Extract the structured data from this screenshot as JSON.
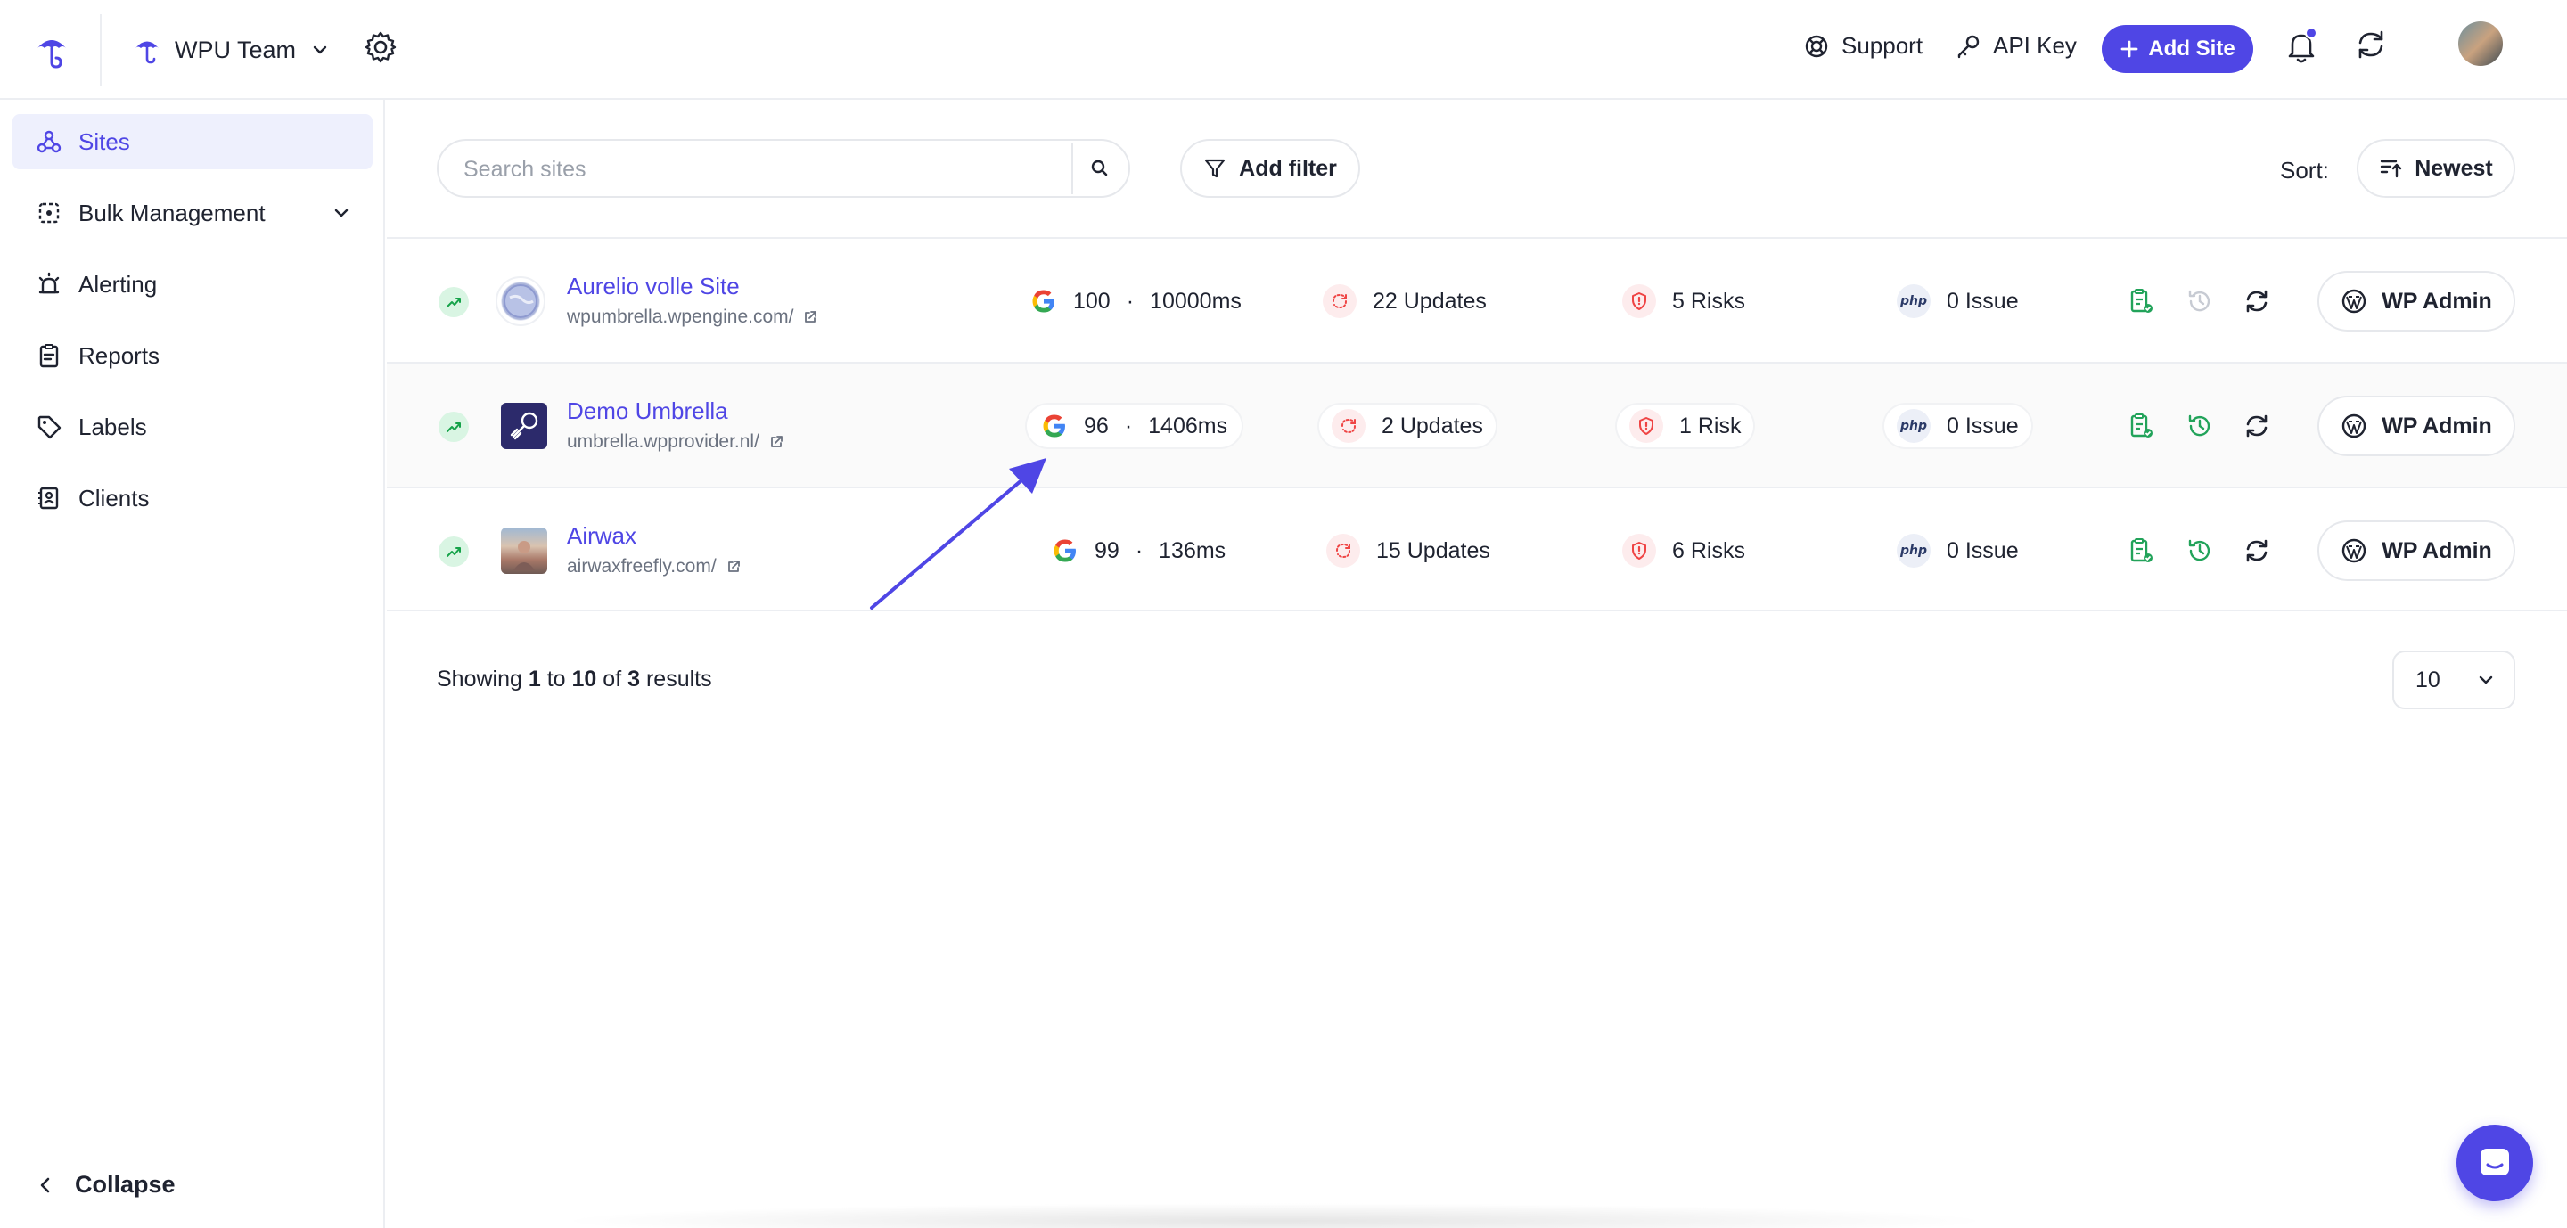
{
  "header": {
    "team_name": "WPU Team",
    "support_label": "Support",
    "api_key_label": "API Key",
    "add_site_label": "Add Site",
    "brand_color": "#4f46e5"
  },
  "sidebar": {
    "items": [
      {
        "label": "Sites",
        "icon": "sites-icon",
        "active": true
      },
      {
        "label": "Bulk Management",
        "icon": "bulk-management-icon"
      },
      {
        "label": "Alerting",
        "icon": "alerting-icon"
      },
      {
        "label": "Reports",
        "icon": "reports-icon"
      },
      {
        "label": "Labels",
        "icon": "label-icon"
      },
      {
        "label": "Clients",
        "icon": "clients-icon"
      }
    ],
    "collapse_label": "Collapse"
  },
  "toolbar": {
    "search_placeholder": "Search sites",
    "add_filter_label": "Add filter",
    "sort_label": "Sort:",
    "sort_value": "Newest"
  },
  "sites": [
    {
      "name": "Aurelio volle Site",
      "url": "wpumbrella.wpengine.com/",
      "score": "100",
      "time": "10000ms",
      "updates": "22 Updates",
      "risks": "5 Risks",
      "issues": "0 Issue",
      "backup_active": false,
      "wp_admin": "WP Admin"
    },
    {
      "name": "Demo Umbrella",
      "url": "umbrella.wpprovider.nl/",
      "score": "96",
      "time": "1406ms",
      "updates": "2 Updates",
      "risks": "1 Risk",
      "issues": "0 Issue",
      "backup_active": true,
      "wp_admin": "WP Admin"
    },
    {
      "name": "Airwax",
      "url": "airwaxfreefly.com/",
      "score": "99",
      "time": "136ms",
      "updates": "15 Updates",
      "risks": "6 Risks",
      "issues": "0 Issue",
      "backup_active": true,
      "wp_admin": "WP Admin"
    }
  ],
  "pagination": {
    "prefix": "Showing",
    "from": "1",
    "to_word": "to",
    "to": "10",
    "of_word": "of",
    "total": "3",
    "suffix": "results",
    "per_page": "10"
  },
  "php_label": "php",
  "separator": "·"
}
